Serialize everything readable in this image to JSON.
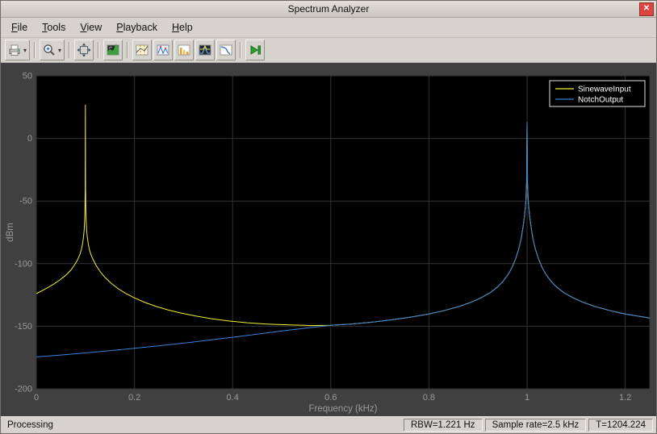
{
  "window": {
    "title": "Spectrum Analyzer",
    "close_glyph": "✕"
  },
  "menubar": {
    "items": [
      {
        "label": "File",
        "underline": 0
      },
      {
        "label": "Tools",
        "underline": 0
      },
      {
        "label": "View",
        "underline": 0
      },
      {
        "label": "Playback",
        "underline": 0
      },
      {
        "label": "Help",
        "underline": 0
      }
    ]
  },
  "toolbar": {
    "buttons": [
      {
        "name": "print-export",
        "icon": "printer-icon",
        "dropdown": true
      },
      {
        "name": "zoom",
        "icon": "magnifier-icon",
        "dropdown": true
      },
      {
        "name": "fit-to-view",
        "icon": "expand-icon",
        "dropdown": false
      },
      {
        "name": "spectrum-settings",
        "icon": "spectrum-image-icon",
        "dropdown": false
      },
      {
        "name": "cursor-measurements",
        "icon": "cursor-measure-icon",
        "dropdown": false
      },
      {
        "name": "peak-finder",
        "icon": "peak-finder-icon",
        "dropdown": false
      },
      {
        "name": "distortion-measurements",
        "icon": "distortion-icon",
        "dropdown": false
      },
      {
        "name": "spectral-mask",
        "icon": "spectral-mask-icon",
        "dropdown": false
      },
      {
        "name": "ccdf-measurements",
        "icon": "ccdf-icon",
        "dropdown": false
      },
      {
        "name": "run-playback",
        "icon": "play-step-icon",
        "dropdown": false
      }
    ],
    "separators_after": [
      0,
      1,
      2,
      3,
      8
    ]
  },
  "statusbar": {
    "processing_label": "Processing",
    "cells": [
      {
        "name": "rbw",
        "text": "RBW=1.221 Hz"
      },
      {
        "name": "sample-rate",
        "text": "Sample rate=2.5 kHz"
      },
      {
        "name": "time",
        "text": "T=1204.224"
      }
    ]
  },
  "chart_data": {
    "type": "line",
    "title": "",
    "xlabel": "Frequency (kHz)",
    "ylabel": "dBm",
    "xlim": [
      0,
      1.25
    ],
    "ylim": [
      -200,
      50
    ],
    "xticks": [
      0,
      0.2,
      0.4,
      0.6,
      0.8,
      1,
      1.2
    ],
    "xtick_labels": [
      "0",
      "0.2",
      "0.4",
      "0.6",
      "0.8",
      "1",
      "1.2"
    ],
    "yticks": [
      50,
      0,
      -50,
      -100,
      -150,
      -200
    ],
    "ytick_labels": [
      "50",
      "0",
      "-50",
      "-100",
      "-150",
      "-200"
    ],
    "grid": true,
    "legend": {
      "position": "top-right"
    },
    "colors": {
      "panel_bg": "#404040",
      "plot_bg": "#000000",
      "grid": "#333333",
      "tick_text": "#9a9a9a",
      "legend_border": "#e0e0e0",
      "legend_text": "#ffffff"
    },
    "series": [
      {
        "name": "SinewaveInput",
        "color": "#f2ef35",
        "points": [
          [
            0,
            -124
          ],
          [
            0.012,
            -121.5
          ],
          [
            0.024,
            -119
          ],
          [
            0.036,
            -116.2
          ],
          [
            0.048,
            -113
          ],
          [
            0.06,
            -109.3
          ],
          [
            0.07,
            -105.3
          ],
          [
            0.078,
            -101
          ],
          [
            0.084,
            -97
          ],
          [
            0.089,
            -92.5
          ],
          [
            0.092,
            -88.5
          ],
          [
            0.094,
            -84.5
          ],
          [
            0.096,
            -79
          ],
          [
            0.0975,
            -73
          ],
          [
            0.0985,
            -65
          ],
          [
            0.0992,
            -55
          ],
          [
            0.0997,
            -40
          ],
          [
            0.1,
            27
          ],
          [
            0.1003,
            -40
          ],
          [
            0.1008,
            -55
          ],
          [
            0.1015,
            -65
          ],
          [
            0.1025,
            -73
          ],
          [
            0.104,
            -79
          ],
          [
            0.106,
            -84.5
          ],
          [
            0.108,
            -88.5
          ],
          [
            0.111,
            -92.5
          ],
          [
            0.116,
            -97
          ],
          [
            0.122,
            -101.5
          ],
          [
            0.13,
            -106.3
          ],
          [
            0.14,
            -111
          ],
          [
            0.152,
            -115.5
          ],
          [
            0.166,
            -119.8
          ],
          [
            0.182,
            -123.8
          ],
          [
            0.2,
            -127.4
          ],
          [
            0.22,
            -130.8
          ],
          [
            0.243,
            -134
          ],
          [
            0.268,
            -136.9
          ],
          [
            0.295,
            -139.5
          ],
          [
            0.325,
            -141.9
          ],
          [
            0.357,
            -144
          ],
          [
            0.392,
            -145.8
          ],
          [
            0.43,
            -147.2
          ],
          [
            0.47,
            -148.3
          ],
          [
            0.515,
            -149
          ],
          [
            0.56,
            -149.4
          ],
          [
            0.6,
            -149.3
          ],
          [
            0.64,
            -148.3
          ],
          [
            0.68,
            -146.9
          ],
          [
            0.72,
            -145.1
          ],
          [
            0.76,
            -142.9
          ],
          [
            0.8,
            -140.2
          ],
          [
            0.83,
            -137.6
          ],
          [
            0.86,
            -134.4
          ],
          [
            0.885,
            -131
          ],
          [
            0.905,
            -127.6
          ],
          [
            0.925,
            -123.2
          ],
          [
            0.94,
            -118.6
          ],
          [
            0.952,
            -113.7
          ],
          [
            0.962,
            -108.3
          ],
          [
            0.97,
            -102.5
          ],
          [
            0.977,
            -95.8
          ],
          [
            0.983,
            -88.4
          ],
          [
            0.988,
            -80
          ],
          [
            0.992,
            -70.5
          ],
          [
            0.995,
            -61
          ],
          [
            0.9975,
            -50
          ],
          [
            0.999,
            -36
          ],
          [
            1.0,
            13
          ],
          [
            1.001,
            -36
          ],
          [
            1.0025,
            -50
          ],
          [
            1.005,
            -61
          ],
          [
            1.008,
            -70.5
          ],
          [
            1.012,
            -80
          ],
          [
            1.017,
            -88.4
          ],
          [
            1.023,
            -95.8
          ],
          [
            1.03,
            -102.5
          ],
          [
            1.038,
            -108.3
          ],
          [
            1.048,
            -113.7
          ],
          [
            1.06,
            -118.6
          ],
          [
            1.075,
            -123.2
          ],
          [
            1.095,
            -127.6
          ],
          [
            1.115,
            -131
          ],
          [
            1.14,
            -134.4
          ],
          [
            1.17,
            -137.6
          ],
          [
            1.2,
            -140.2
          ],
          [
            1.25,
            -143.5
          ]
        ]
      },
      {
        "name": "NotchOutput",
        "color": "#3b82d6",
        "points": [
          [
            0,
            -174.5
          ],
          [
            0.05,
            -173
          ],
          [
            0.1,
            -171.3
          ],
          [
            0.15,
            -169.5
          ],
          [
            0.2,
            -167.6
          ],
          [
            0.25,
            -165.6
          ],
          [
            0.3,
            -163.5
          ],
          [
            0.35,
            -161.2
          ],
          [
            0.4,
            -158.8
          ],
          [
            0.45,
            -156.3
          ],
          [
            0.5,
            -153.8
          ],
          [
            0.55,
            -151.5
          ],
          [
            0.6,
            -149.3
          ],
          [
            0.64,
            -148.3
          ],
          [
            0.68,
            -146.9
          ],
          [
            0.72,
            -145.1
          ],
          [
            0.76,
            -142.9
          ],
          [
            0.8,
            -140.2
          ],
          [
            0.83,
            -137.6
          ],
          [
            0.86,
            -134.4
          ],
          [
            0.885,
            -131
          ],
          [
            0.905,
            -127.6
          ],
          [
            0.925,
            -123.2
          ],
          [
            0.94,
            -118.6
          ],
          [
            0.952,
            -113.7
          ],
          [
            0.962,
            -108.3
          ],
          [
            0.97,
            -102.5
          ],
          [
            0.977,
            -95.8
          ],
          [
            0.983,
            -88.4
          ],
          [
            0.988,
            -80
          ],
          [
            0.992,
            -70.5
          ],
          [
            0.995,
            -61
          ],
          [
            0.9975,
            -50
          ],
          [
            0.999,
            -36
          ],
          [
            1.0,
            13
          ],
          [
            1.001,
            -36
          ],
          [
            1.0025,
            -50
          ],
          [
            1.005,
            -61
          ],
          [
            1.008,
            -70.5
          ],
          [
            1.012,
            -80
          ],
          [
            1.017,
            -88.4
          ],
          [
            1.023,
            -95.8
          ],
          [
            1.03,
            -102.5
          ],
          [
            1.038,
            -108.3
          ],
          [
            1.048,
            -113.7
          ],
          [
            1.06,
            -118.6
          ],
          [
            1.075,
            -123.2
          ],
          [
            1.095,
            -127.6
          ],
          [
            1.115,
            -131
          ],
          [
            1.14,
            -134.4
          ],
          [
            1.17,
            -137.6
          ],
          [
            1.2,
            -140.2
          ],
          [
            1.25,
            -143.5
          ]
        ]
      }
    ]
  }
}
